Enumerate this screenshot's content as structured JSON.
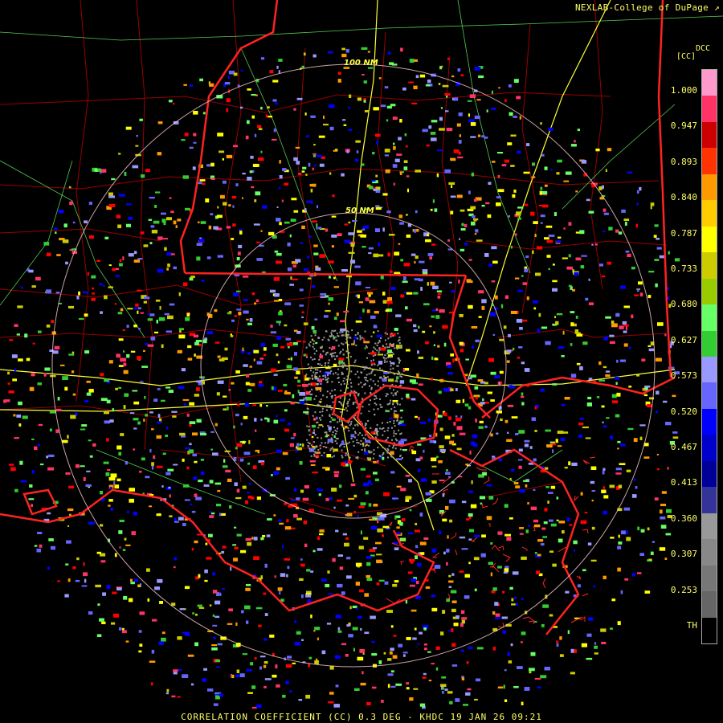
{
  "credit": "NEXLAB-College of DuPage",
  "product": "DCC",
  "units": "[CC]",
  "footer": "CORRELATION COEFFICIENT (CC) 0.3 DEG - KHDC 19 JAN 26 09:21",
  "rings": {
    "inner_label": "50 NM",
    "outer_label": "100 NM"
  },
  "legend": {
    "ticks": [
      "1.000",
      "0.947",
      "0.893",
      "0.840",
      "0.787",
      "0.733",
      "0.680",
      "0.627",
      "0.573",
      "0.520",
      "0.467",
      "0.413",
      "0.360",
      "0.307",
      "0.253",
      "TH"
    ],
    "colors": [
      "#ff99cc",
      "#ff3366",
      "#cc0000",
      "#ff3300",
      "#ff9900",
      "#ffcc00",
      "#ffff00",
      "#cccc00",
      "#99cc00",
      "#66ff66",
      "#33cc33",
      "#9999ff",
      "#6666ff",
      "#0000ff",
      "#0000cc",
      "#000099",
      "#333399",
      "#999999",
      "#888888",
      "#777777",
      "#666666",
      "#000000"
    ]
  },
  "colors": {
    "state_border": "#ff2222",
    "county": "#990000",
    "highway": "#ffff33",
    "road": "#66ff66",
    "range_ring": "#ffcccc"
  },
  "icons": [
    "external-link-icon"
  ]
}
